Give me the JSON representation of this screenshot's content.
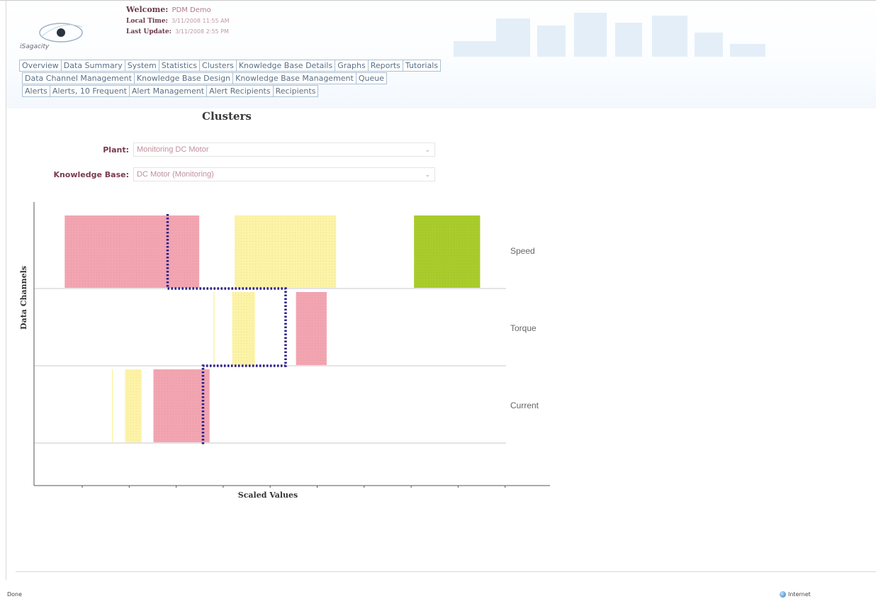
{
  "header": {
    "logo_text": "iSagacity",
    "welcome_label": "Welcome:",
    "welcome_value": "PDM Demo",
    "local_time_label": "Local Time:",
    "local_time_value": "3/11/2008 11:55 AM",
    "last_update_label": "Last Update:",
    "last_update_value": "3/11/2008 2:55 PM"
  },
  "nav": {
    "row1": [
      "Overview",
      "Data Summary",
      "System",
      "Statistics",
      "Clusters",
      "Knowledge Base Details",
      "Graphs",
      "Reports",
      "Tutorials"
    ],
    "row2": [
      "Data Channel Management",
      "Knowledge Base Design",
      "Knowledge Base Management",
      "Queue"
    ],
    "row3": [
      "Alerts",
      "Alerts, 10 Frequent",
      "Alert Management",
      "Alert Recipients",
      "Recipients"
    ]
  },
  "page_title": "Clusters",
  "form": {
    "plant_label": "Plant:",
    "plant_value": "Monitoring DC Motor",
    "kb_label": "Knowledge Base:",
    "kb_value": "DC Motor (Monitoring)"
  },
  "chart_data": {
    "type": "bar",
    "title": "",
    "xlabel": "Scaled Values",
    "ylabel": "Data Channels",
    "categories": [
      "Speed",
      "Torque",
      "Current"
    ],
    "grid": false,
    "colors": {
      "red": "#f2a5b1",
      "yellow": "#fdf3a6",
      "green": "#a9cc2c",
      "path": "#2b1f8c",
      "axis": "#555555"
    },
    "clusters": [
      {
        "channel": "Speed",
        "x_start": 0.065,
        "x_end": 0.35,
        "color": "red"
      },
      {
        "channel": "Speed",
        "x_start": 0.425,
        "x_end": 0.64,
        "color": "yellow"
      },
      {
        "channel": "Speed",
        "x_start": 0.805,
        "x_end": 0.945,
        "color": "green"
      },
      {
        "channel": "Torque",
        "x_start": 0.38,
        "x_end": 0.382,
        "color": "yellow"
      },
      {
        "channel": "Torque",
        "x_start": 0.42,
        "x_end": 0.468,
        "color": "yellow"
      },
      {
        "channel": "Torque",
        "x_start": 0.555,
        "x_end": 0.62,
        "color": "red"
      },
      {
        "channel": "Current",
        "x_start": 0.165,
        "x_end": 0.167,
        "color": "yellow"
      },
      {
        "channel": "Current",
        "x_start": 0.193,
        "x_end": 0.228,
        "color": "yellow"
      },
      {
        "channel": "Current",
        "x_start": 0.253,
        "x_end": 0.372,
        "color": "red"
      }
    ],
    "path_x": {
      "Speed": 0.283,
      "Torque": 0.533,
      "Current": 0.358
    }
  },
  "status": {
    "left": "Done",
    "right": "Internet"
  }
}
